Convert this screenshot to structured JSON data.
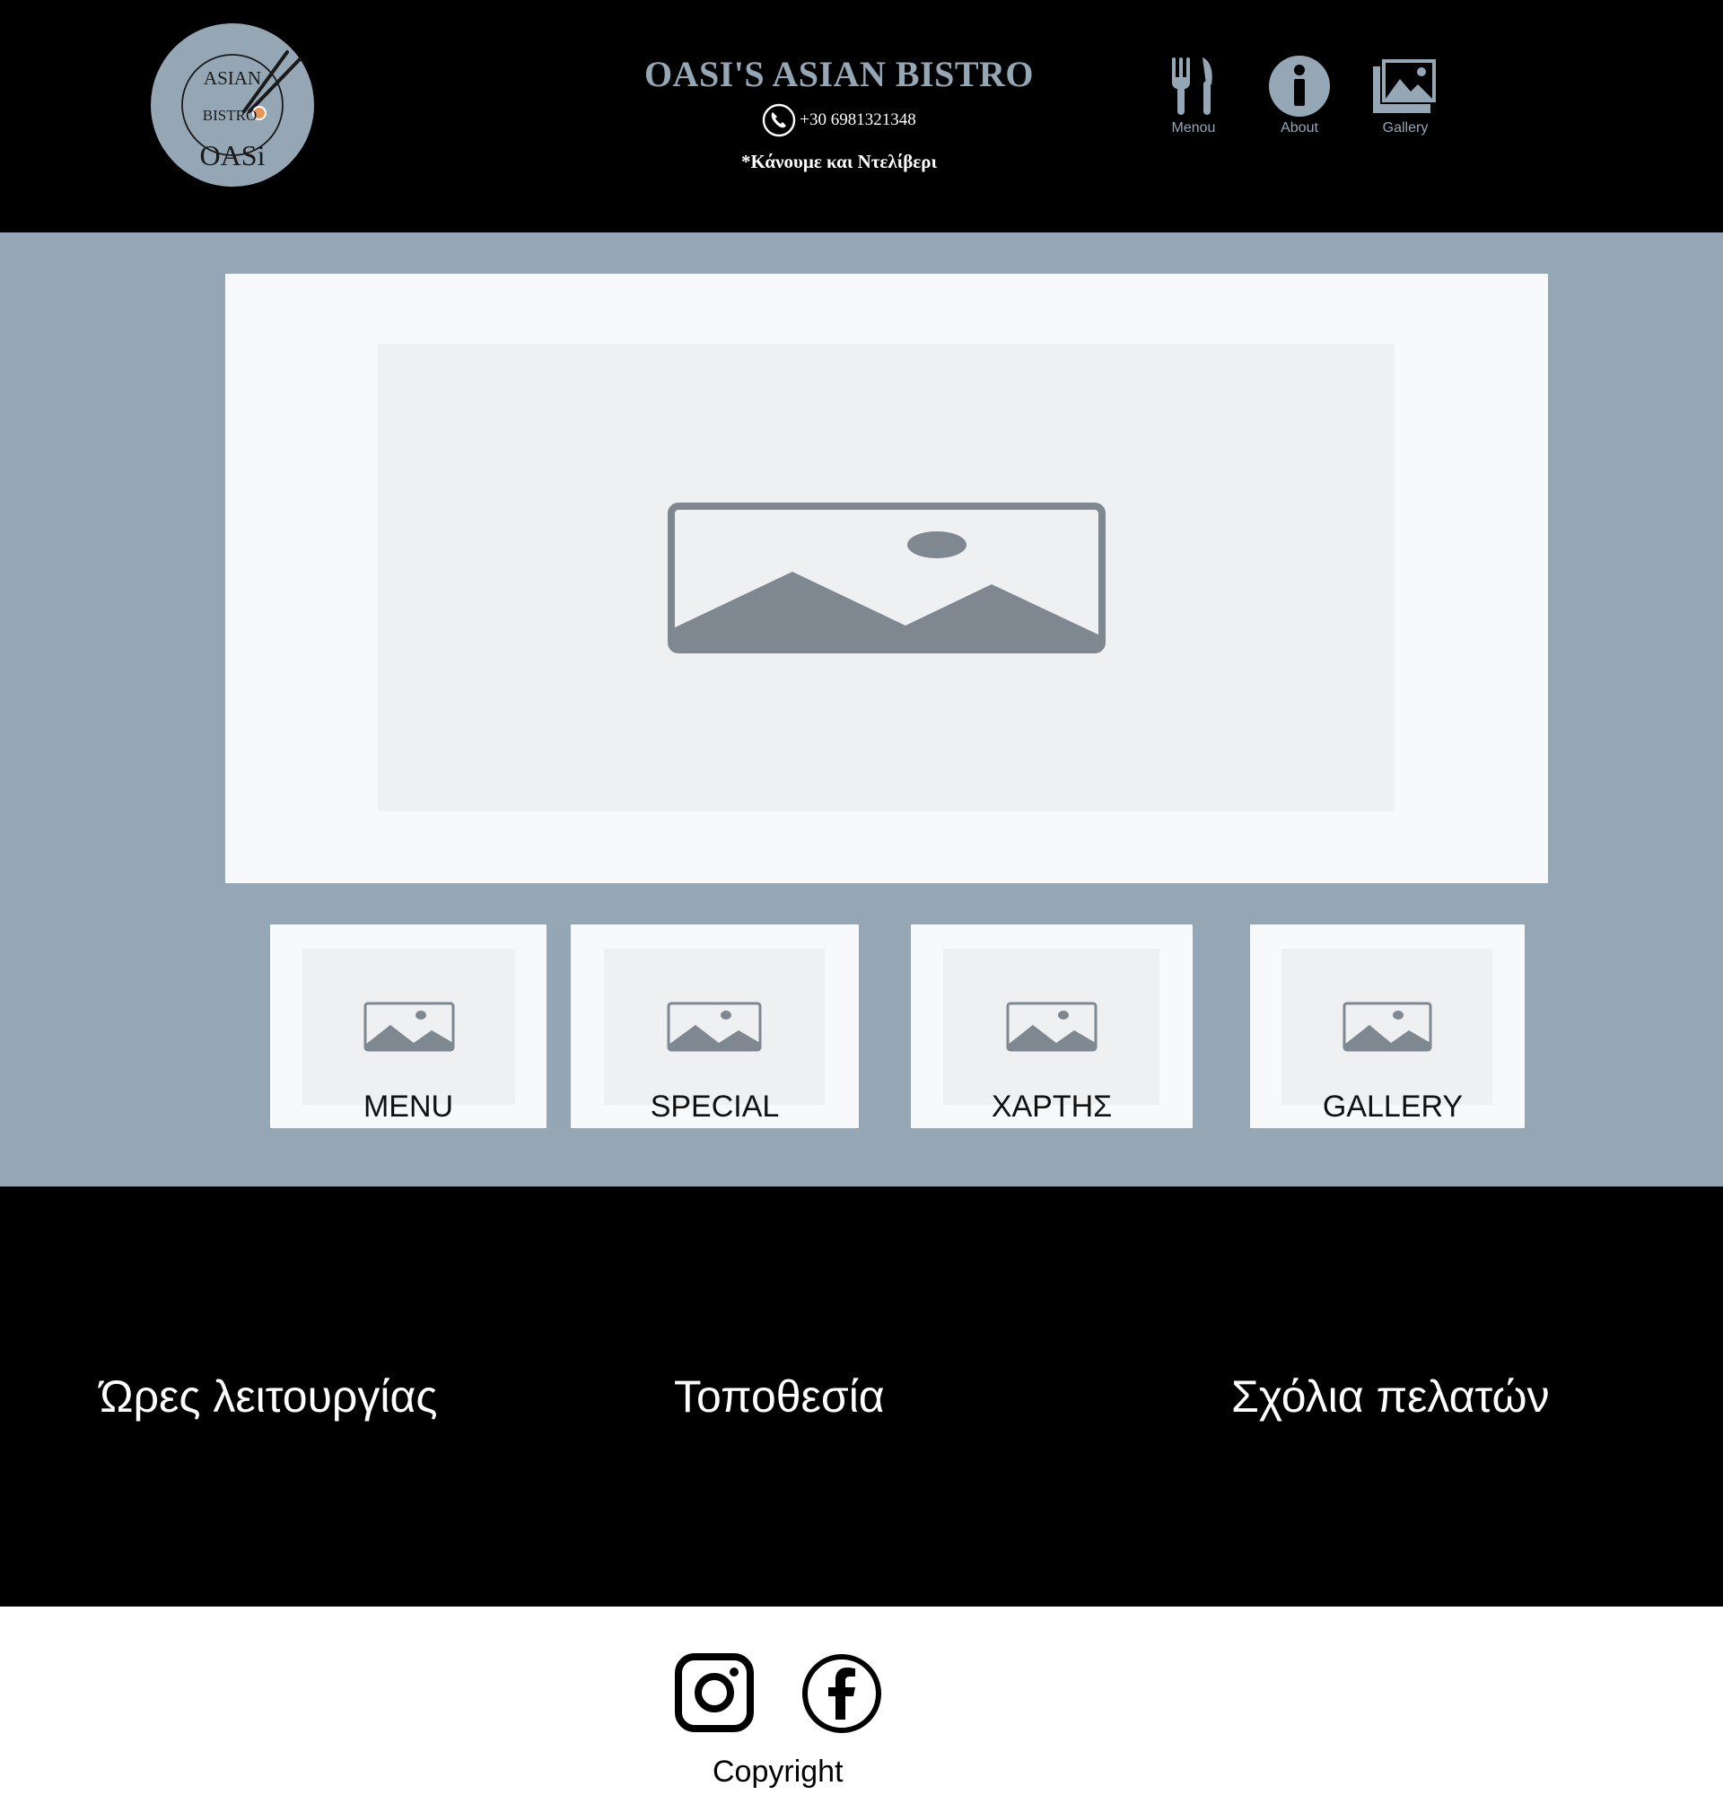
{
  "header": {
    "logo": {
      "line1": "ASIAN",
      "line2": "BISTRO",
      "line3": "OASi"
    },
    "title": "OASI'S ASIAN BISTRO",
    "phone": "+30 6981321348",
    "delivery_note": "*Κάνουμε και Ντελίβερι",
    "nav": [
      {
        "label": "Menou",
        "icon": "cutlery-icon"
      },
      {
        "label": "About",
        "icon": "info-icon"
      },
      {
        "label": "Gallery",
        "icon": "gallery-icon"
      }
    ]
  },
  "cards": [
    {
      "label": "MENU"
    },
    {
      "label": "SPECIAL"
    },
    {
      "label": "ΧΑΡΤΗΣ"
    },
    {
      "label": "GALLERY"
    }
  ],
  "info": {
    "hours_title": "Ώρες λειτουργίας",
    "location_title": "Τοποθεσία",
    "reviews_title": "Σχόλια πελατών"
  },
  "footer": {
    "social": [
      {
        "icon": "instagram-icon"
      },
      {
        "icon": "facebook-icon"
      }
    ],
    "copyright": "Copyright"
  },
  "colors": {
    "header_bg": "#000000",
    "accent": "#95a7b5",
    "panel": "#f8f9fb",
    "placeholder": "#eef0f2",
    "placeholder_icon": "#7f8891",
    "logo_accent": "#e8955c"
  }
}
